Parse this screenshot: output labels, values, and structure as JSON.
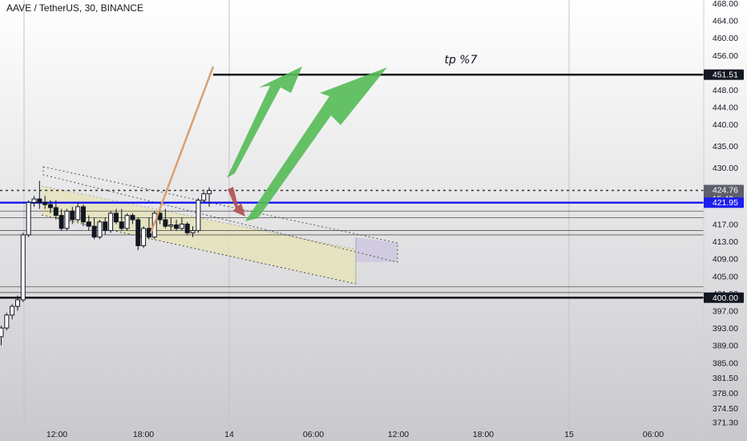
{
  "header": {
    "symbol_title": "AAVE / TetherUS, 30, BINANCE"
  },
  "annotations": {
    "target_label": "tp %7"
  },
  "colors": {
    "background_top": "#ffffff",
    "background_bottom": "#c9c9cd",
    "up_candle": "#ffffff",
    "down_candle": "#131722",
    "blue_line": "#1e1ef0",
    "arrow_green": "#55bb55",
    "arrow_red": "#b05050",
    "channel_fill": "#e6e3b4",
    "projection_fill": "#cdc6e0",
    "orange_line": "#d9a070"
  },
  "chart_data": {
    "type": "candlestick",
    "symbol": "AAVE / TetherUS",
    "interval": "30",
    "exchange": "BINANCE",
    "ylim": [
      369.5,
      468.0
    ],
    "y_ticks": [
      468.0,
      464.0,
      460.0,
      456.0,
      451.51,
      448.0,
      444.0,
      440.0,
      435.0,
      430.0,
      424.76,
      421.95,
      417.0,
      413.0,
      409.0,
      405.0,
      401.0,
      400.0,
      397.0,
      393.0,
      389.0,
      385.0,
      381.5,
      378.0,
      374.5,
      371.3
    ],
    "x_ticks": [
      "12:00",
      "18:00",
      "14",
      "06:00",
      "12:00",
      "18:00",
      "15",
      "06:00"
    ],
    "price_tags": [
      {
        "label": "451.51",
        "value": 451.51,
        "style": "black"
      },
      {
        "label": "424.76",
        "value": 424.76,
        "style": "gray",
        "sub": "15:42"
      },
      {
        "label": "421.95",
        "value": 421.95,
        "style": "blue"
      },
      {
        "label": "400.00",
        "value": 400.0,
        "style": "black"
      }
    ],
    "horizontal_levels": [
      {
        "value": 451.51,
        "style": "thick-black"
      },
      {
        "value": 424.76,
        "style": "dotted"
      },
      {
        "value": 421.95,
        "style": "blue"
      },
      {
        "value": 420.0,
        "style": "thin"
      },
      {
        "value": 418.5,
        "style": "thin"
      },
      {
        "value": 415.5,
        "style": "thin"
      },
      {
        "value": 414.5,
        "style": "thin"
      },
      {
        "value": 402.5,
        "style": "thin"
      },
      {
        "value": 401.2,
        "style": "thin"
      },
      {
        "value": 400.0,
        "style": "thick-black"
      }
    ],
    "candles": [
      {
        "o": 391.0,
        "h": 393.5,
        "l": 389.0,
        "c": 393.0
      },
      {
        "o": 393.0,
        "h": 396.5,
        "l": 392.5,
        "c": 396.0
      },
      {
        "o": 396.0,
        "h": 398.5,
        "l": 395.0,
        "c": 398.0
      },
      {
        "o": 398.0,
        "h": 400.5,
        "l": 397.0,
        "c": 399.5
      },
      {
        "o": 399.5,
        "h": 415.0,
        "l": 399.0,
        "c": 414.5
      },
      {
        "o": 414.5,
        "h": 422.5,
        "l": 414.0,
        "c": 422.0
      },
      {
        "o": 422.0,
        "h": 423.5,
        "l": 421.0,
        "c": 422.8
      },
      {
        "o": 422.8,
        "h": 427.0,
        "l": 420.5,
        "c": 422.0
      },
      {
        "o": 422.0,
        "h": 423.5,
        "l": 420.5,
        "c": 421.5
      },
      {
        "o": 421.5,
        "h": 422.5,
        "l": 419.5,
        "c": 420.8
      },
      {
        "o": 420.8,
        "h": 422.5,
        "l": 418.0,
        "c": 419.0
      },
      {
        "o": 419.0,
        "h": 420.5,
        "l": 415.5,
        "c": 416.0
      },
      {
        "o": 416.0,
        "h": 420.5,
        "l": 415.5,
        "c": 420.0
      },
      {
        "o": 420.0,
        "h": 421.0,
        "l": 417.0,
        "c": 418.0
      },
      {
        "o": 418.0,
        "h": 422.0,
        "l": 417.5,
        "c": 421.0
      },
      {
        "o": 421.0,
        "h": 421.5,
        "l": 416.5,
        "c": 417.5
      },
      {
        "o": 417.5,
        "h": 419.0,
        "l": 415.5,
        "c": 416.5
      },
      {
        "o": 416.5,
        "h": 418.5,
        "l": 413.5,
        "c": 414.0
      },
      {
        "o": 414.0,
        "h": 418.0,
        "l": 413.5,
        "c": 417.5
      },
      {
        "o": 417.5,
        "h": 418.5,
        "l": 414.5,
        "c": 415.5
      },
      {
        "o": 415.5,
        "h": 420.0,
        "l": 415.0,
        "c": 419.5
      },
      {
        "o": 419.5,
        "h": 420.5,
        "l": 417.0,
        "c": 417.5
      },
      {
        "o": 417.5,
        "h": 420.5,
        "l": 415.5,
        "c": 416.0
      },
      {
        "o": 416.0,
        "h": 419.5,
        "l": 415.5,
        "c": 419.0
      },
      {
        "o": 419.0,
        "h": 419.5,
        "l": 417.0,
        "c": 418.0
      },
      {
        "o": 418.0,
        "h": 418.5,
        "l": 411.0,
        "c": 412.0
      },
      {
        "o": 412.0,
        "h": 416.5,
        "l": 411.5,
        "c": 416.0
      },
      {
        "o": 416.0,
        "h": 418.5,
        "l": 413.5,
        "c": 414.0
      },
      {
        "o": 414.0,
        "h": 420.0,
        "l": 413.5,
        "c": 419.5
      },
      {
        "o": 419.5,
        "h": 420.0,
        "l": 417.0,
        "c": 418.0
      },
      {
        "o": 418.0,
        "h": 420.5,
        "l": 416.0,
        "c": 416.5
      },
      {
        "o": 416.5,
        "h": 418.5,
        "l": 415.5,
        "c": 416.8
      },
      {
        "o": 416.8,
        "h": 418.0,
        "l": 415.5,
        "c": 416.0
      },
      {
        "o": 416.0,
        "h": 418.5,
        "l": 415.5,
        "c": 417.0
      },
      {
        "o": 417.0,
        "h": 417.5,
        "l": 414.5,
        "c": 415.0
      },
      {
        "o": 415.0,
        "h": 416.5,
        "l": 414.0,
        "c": 415.5
      },
      {
        "o": 415.5,
        "h": 423.0,
        "l": 415.0,
        "c": 422.5
      },
      {
        "o": 422.5,
        "h": 424.5,
        "l": 422.0,
        "c": 424.0
      },
      {
        "o": 424.0,
        "h": 425.5,
        "l": 421.0,
        "c": 424.76
      }
    ]
  }
}
